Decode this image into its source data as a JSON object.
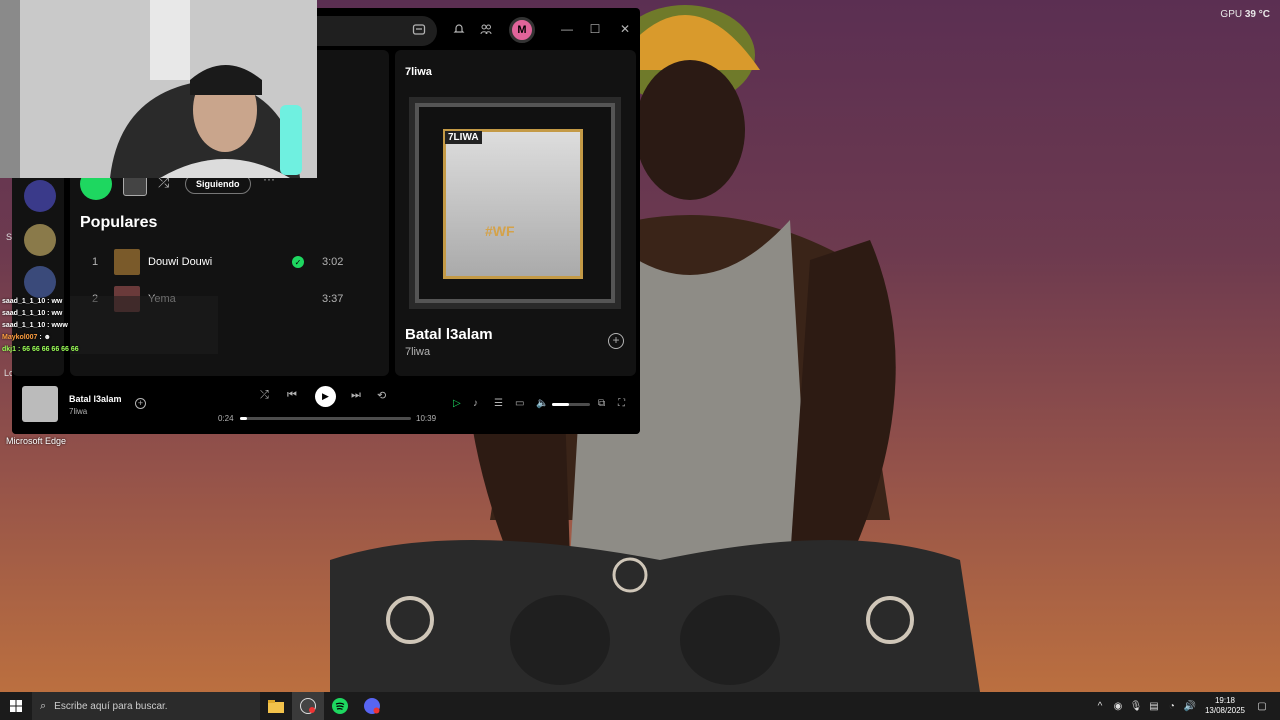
{
  "system_overlay": {
    "gpu_label": "GPU",
    "gpu_temp": "39 °C"
  },
  "desktop": {
    "edge_label": "Microsoft Edge",
    "edge_letters": [
      "S",
      "Lo"
    ]
  },
  "chat": {
    "lines": [
      {
        "user": "saad_1_1_10",
        "text": " : ww",
        "color": "#ffffff"
      },
      {
        "user": "saad_1_1_10",
        "text": " : ww",
        "color": "#ffffff"
      },
      {
        "user": "saad_1_1_10",
        "text": " : www",
        "color": "#ffffff"
      },
      {
        "user": "Maykol007",
        "text": " : ",
        "color": "#ff9f40"
      },
      {
        "user": "dkj1",
        "text": " : 66 66 66 66 66 66",
        "color": "#9cff57"
      }
    ]
  },
  "spotify": {
    "avatar_initial": "M",
    "artist_page": {
      "follow_label": "Siguiendo",
      "more_label": "···",
      "section_title": "Populares",
      "tracks": [
        {
          "num": "1",
          "name": "Douwi Douwi",
          "duration": "3:02",
          "saved": true
        },
        {
          "num": "2",
          "name": "Yema",
          "duration": "3:37",
          "saved": false
        }
      ]
    },
    "now_playing_panel": {
      "header": "7liwa",
      "art_brand": "7LIWA",
      "art_tag": "#WF",
      "title": "Batal l3alam",
      "artist": "7liwa"
    },
    "player": {
      "title": "Batal l3alam",
      "artist": "7liwa",
      "elapsed": "0:24",
      "total": "10:39",
      "progress": 0.04,
      "volume": 0.45
    }
  },
  "taskbar": {
    "search_placeholder": "Escribe aquí para buscar.",
    "time": "19:18",
    "date": "13/08/2025"
  },
  "colors": {
    "spotify_green": "#1ed760",
    "avatar_pink": "#e0649a"
  }
}
